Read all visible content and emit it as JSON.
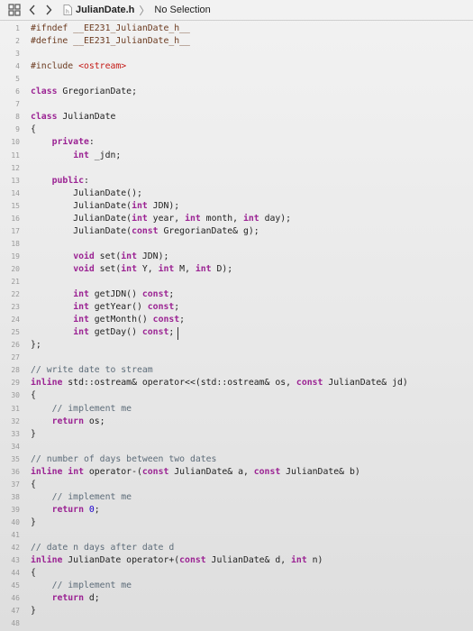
{
  "jumpbar": {
    "grid_icon": "grid-icon",
    "back_icon": "chevron-left-icon",
    "forward_icon": "chevron-right-icon",
    "file_icon": "header-file-icon",
    "file_name": "JulianDate.h",
    "separator": "〉",
    "selection": "No Selection"
  },
  "colors": {
    "keyword": "#9b2393",
    "preprocessor": "#6b3a1f",
    "include_path": "#c41a16",
    "comment": "#5d6c79",
    "number": "#1c00cf",
    "line_number": "#999999"
  },
  "code": {
    "lines": [
      "#ifndef __EE231_JulianDate_h__",
      "#define __EE231_JulianDate_h__",
      "",
      "#include <ostream>",
      "",
      "class GregorianDate;",
      "",
      "class JulianDate",
      "{",
      "    private:",
      "        int _jdn;",
      "",
      "    public:",
      "        JulianDate();",
      "        JulianDate(int JDN);",
      "        JulianDate(int year, int month, int day);",
      "        JulianDate(const GregorianDate& g);",
      "",
      "        void set(int JDN);",
      "        void set(int Y, int M, int D);",
      "",
      "        int getJDN() const;",
      "        int getYear() const;",
      "        int getMonth() const;",
      "        int getDay() const;",
      "};",
      "",
      "// write date to stream",
      "inline std::ostream& operator<<(std::ostream& os, const JulianDate& jd)",
      "{",
      "    // implement me",
      "    return os;",
      "}",
      "",
      "// number of days between two dates",
      "inline int operator-(const JulianDate& a, const JulianDate& b)",
      "{",
      "    // implement me",
      "    return 0;",
      "}",
      "",
      "// date n days after date d",
      "inline JulianDate operator+(const JulianDate& d, int n)",
      "{",
      "    // implement me",
      "    return d;",
      "}",
      ""
    ],
    "line_numbers": [
      "1",
      "2",
      "3",
      "4",
      "5",
      "6",
      "7",
      "8",
      "9",
      "10",
      "11",
      "12",
      "13",
      "14",
      "15",
      "16",
      "17",
      "18",
      "19",
      "20",
      "21",
      "22",
      "23",
      "24",
      "25",
      "26",
      "27",
      "28",
      "29",
      "30",
      "31",
      "32",
      "33",
      "34",
      "35",
      "36",
      "37",
      "38",
      "39",
      "40",
      "41",
      "42",
      "43",
      "44",
      "45",
      "46",
      "47",
      "48"
    ]
  }
}
